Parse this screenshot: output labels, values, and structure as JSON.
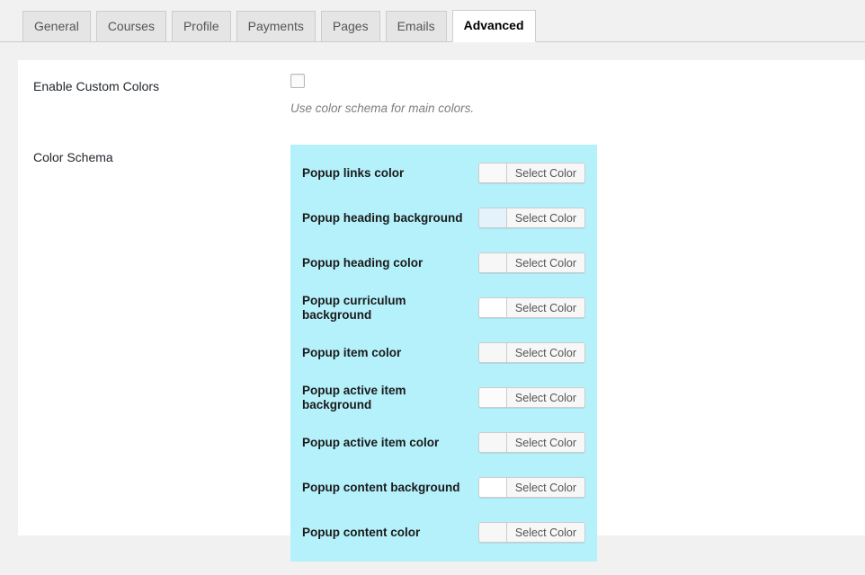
{
  "tabs": [
    {
      "label": "General",
      "active": false
    },
    {
      "label": "Courses",
      "active": false
    },
    {
      "label": "Profile",
      "active": false
    },
    {
      "label": "Payments",
      "active": false
    },
    {
      "label": "Pages",
      "active": false
    },
    {
      "label": "Emails",
      "active": false
    },
    {
      "label": "Advanced",
      "active": true
    }
  ],
  "settings": {
    "enable_custom_colors": {
      "label": "Enable Custom Colors",
      "checked": false,
      "description": "Use color schema for main colors."
    },
    "color_schema": {
      "label": "Color Schema",
      "panel_background": "#b5f1fb",
      "button_label": "Select Color",
      "rows": [
        {
          "label": "Popup links color",
          "swatch": "#f9f9f9"
        },
        {
          "label": "Popup heading background",
          "swatch": "#e3f2fb"
        },
        {
          "label": "Popup heading color",
          "swatch": "#f7f7f7"
        },
        {
          "label": "Popup curriculum background",
          "swatch": "#ffffff"
        },
        {
          "label": "Popup item color",
          "swatch": "#f7f7f7"
        },
        {
          "label": "Popup active item background",
          "swatch": "#fcfcfc"
        },
        {
          "label": "Popup active item color",
          "swatch": "#f7f7f7"
        },
        {
          "label": "Popup content background",
          "swatch": "#ffffff"
        },
        {
          "label": "Popup content color",
          "swatch": "#f7f7f7"
        }
      ]
    }
  }
}
